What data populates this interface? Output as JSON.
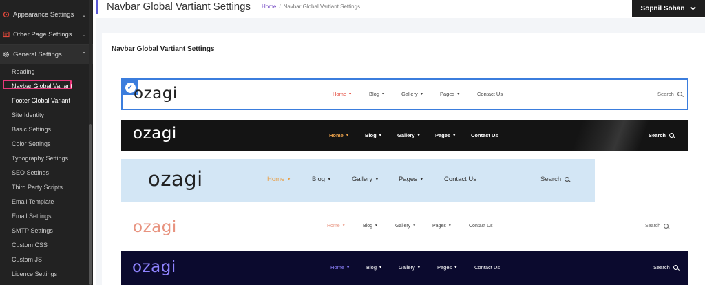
{
  "sidebar": {
    "menus": [
      {
        "label": "Appearance Settings",
        "icon": "appearance-icon"
      },
      {
        "label": "Other Page Settings",
        "icon": "page-icon"
      },
      {
        "label": "General Settings",
        "icon": "gear-icon"
      }
    ],
    "sub_items": [
      "Reading",
      "Navbar Global Variant",
      "Footer Global Variant",
      "Site Identity",
      "Basic Settings",
      "Color Settings",
      "Typography Settings",
      "SEO Settings",
      "Third Party Scripts",
      "Email Template",
      "Email Settings",
      "SMTP Settings",
      "Custom CSS",
      "Custom JS",
      "Licence Settings"
    ]
  },
  "header": {
    "title": "Navbar Global Vartiant Settings",
    "breadcrumb_home": "Home",
    "breadcrumb_current": "Navbar Global Vartiant Settings",
    "user_name": "Sopnil Sohan"
  },
  "card": {
    "title": "Navbar Global Vartiant Settings"
  },
  "navbar_preview": {
    "logo": "ozagi",
    "items": [
      "Home",
      "Blog",
      "Gallery",
      "Pages",
      "Contact Us"
    ],
    "search": "Search"
  },
  "colors": {
    "accent": "#3b7ddd",
    "highlight": "#e8377b",
    "home_red": "#e4493c",
    "home_orange": "#e8a04a",
    "logo_salmon": "#e8937f",
    "logo_purple": "#8f83ff"
  }
}
